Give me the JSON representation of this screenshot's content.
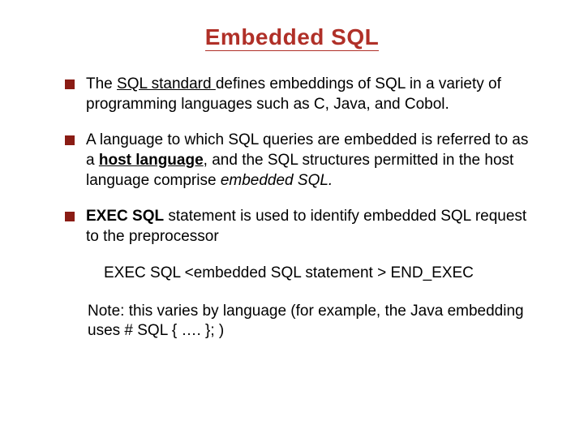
{
  "title_part1": "Embedded ",
  "title_part2": "SQL",
  "bullet1": {
    "pre": "The ",
    "underlined": "SQL standard ",
    "post": "defines embeddings of SQL in a variety of programming languages such as C, Java, and Cobol."
  },
  "bullet2": {
    "seg1": "A language to which SQL queries are embedded is referred to as a ",
    "bold1": "host language",
    "seg2": ", and the SQL structures permitted in the host language comprise ",
    "italic": "embedded SQL.",
    "seg3": ""
  },
  "bullet3": {
    "bold": "EXEC SQL",
    "rest": " statement is used to identify embedded SQL request to the preprocessor"
  },
  "statement": "EXEC SQL <embedded SQL statement > END_EXEC",
  "note": "Note: this varies by language (for example, the Java embedding uses    # SQL { …. }; )"
}
